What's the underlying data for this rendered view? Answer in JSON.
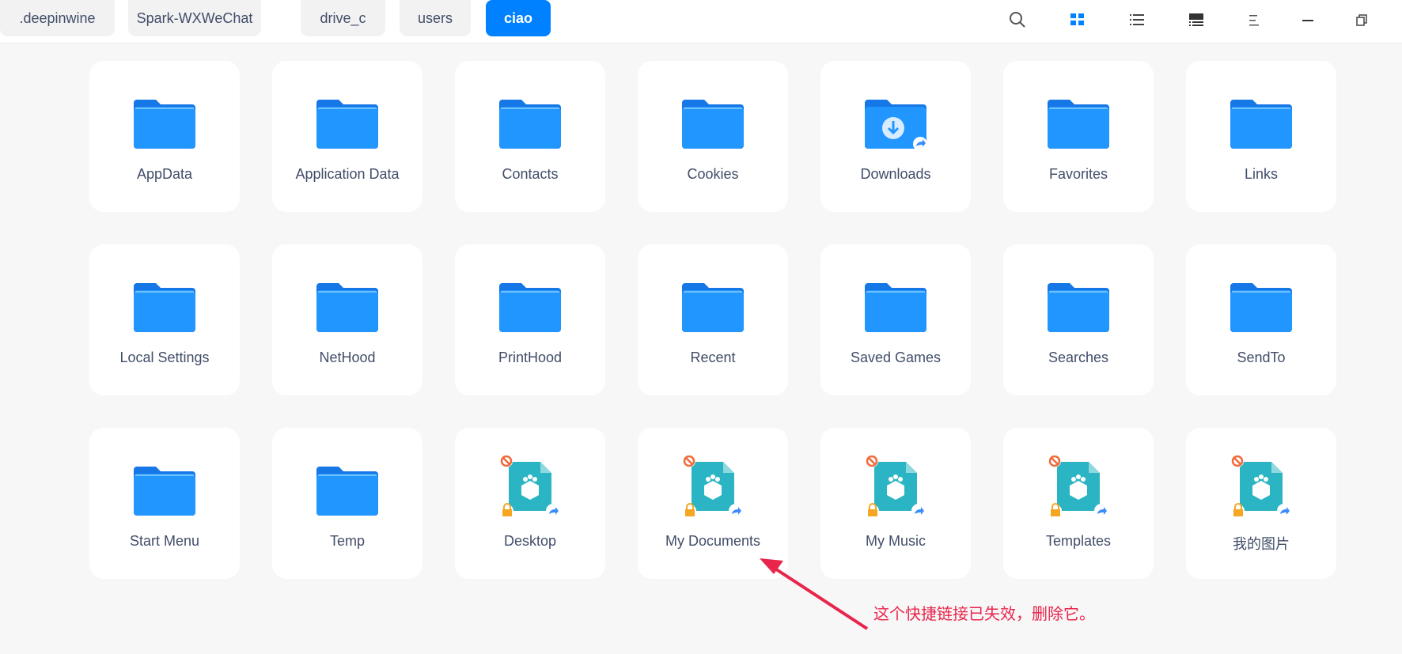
{
  "breadcrumbs": [
    ".deepinwine",
    "Spark-WXWeChat",
    "drive_c",
    "users",
    "ciao"
  ],
  "active_crumb": "ciao",
  "toolbar": [
    "search-icon",
    "icon-view-icon",
    "list-view-icon",
    "detail-view-icon",
    "menu-icon",
    "minimize-icon",
    "restore-icon"
  ],
  "items": [
    {
      "name": "AppData",
      "type": "folder"
    },
    {
      "name": "Application Data",
      "type": "folder"
    },
    {
      "name": "Contacts",
      "type": "folder"
    },
    {
      "name": "Cookies",
      "type": "folder"
    },
    {
      "name": "Downloads",
      "type": "downloads"
    },
    {
      "name": "Favorites",
      "type": "folder"
    },
    {
      "name": "Links",
      "type": "folder"
    },
    {
      "name": "Local Settings",
      "type": "folder"
    },
    {
      "name": "NetHood",
      "type": "folder"
    },
    {
      "name": "PrintHood",
      "type": "folder"
    },
    {
      "name": "Recent",
      "type": "folder"
    },
    {
      "name": "Saved Games",
      "type": "folder"
    },
    {
      "name": "Searches",
      "type": "folder"
    },
    {
      "name": "SendTo",
      "type": "folder"
    },
    {
      "name": "Start Menu",
      "type": "folder"
    },
    {
      "name": "Temp",
      "type": "folder"
    },
    {
      "name": "Desktop",
      "type": "broken-link"
    },
    {
      "name": "My Documents",
      "type": "broken-link"
    },
    {
      "name": "My Music",
      "type": "broken-link"
    },
    {
      "name": "Templates",
      "type": "broken-link"
    },
    {
      "name": "我的图片",
      "type": "broken-link"
    }
  ],
  "annotation": "这个快捷链接已失效，删除它。",
  "colors": {
    "accent": "#0081ff",
    "annotation": "#e8254a",
    "folder": "#1e90ff",
    "broken": "#2bb5c4"
  }
}
